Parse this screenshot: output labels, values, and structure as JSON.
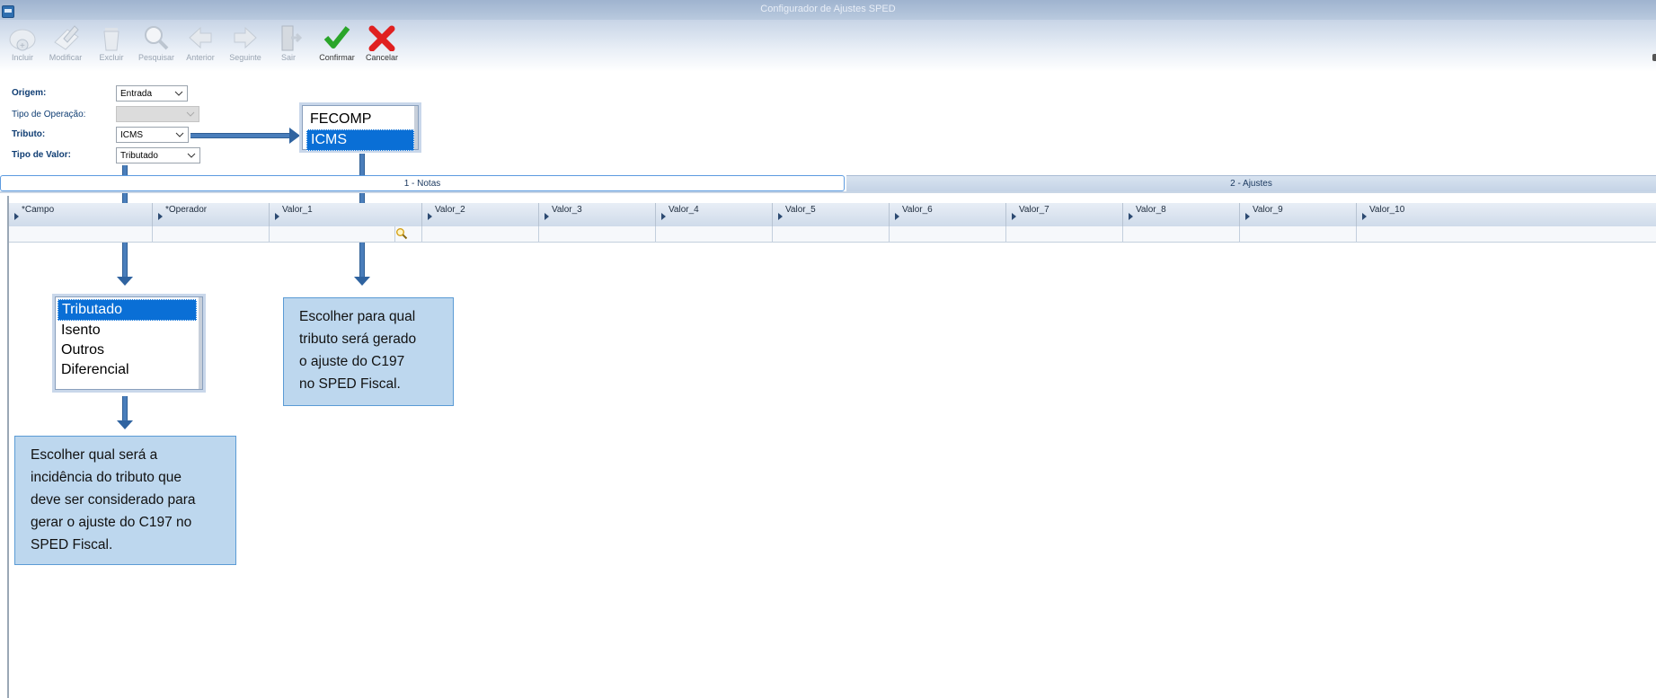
{
  "window": {
    "title": "Configurador de Ajustes SPED"
  },
  "toolbar": {
    "buttons": [
      {
        "label": "Incluir",
        "icon": "include-icon",
        "enabled": false
      },
      {
        "label": "Modificar",
        "icon": "edit-icon",
        "enabled": false
      },
      {
        "label": "Excluir",
        "icon": "trash-icon",
        "enabled": false
      },
      {
        "label": "Pesquisar",
        "icon": "search-icon",
        "enabled": false
      },
      {
        "label": "Anterior",
        "icon": "arrow-left-icon",
        "enabled": false
      },
      {
        "label": "Seguinte",
        "icon": "arrow-right-icon",
        "enabled": false
      },
      {
        "label": "Sair",
        "icon": "exit-door-icon",
        "enabled": false
      },
      {
        "label": "Confirmar",
        "icon": "checkmark-icon",
        "enabled": true
      },
      {
        "label": "Cancelar",
        "icon": "x-icon",
        "enabled": true
      }
    ]
  },
  "form": {
    "origem": {
      "label": "Origem:",
      "value": "Entrada"
    },
    "tipo_operacao": {
      "label": "Tipo de Operação:",
      "value": ""
    },
    "tributo": {
      "label": "Tributo:",
      "value": "ICMS"
    },
    "tipo_valor": {
      "label": "Tipo de Valor:",
      "value": "Tributado"
    }
  },
  "tributo_dropdown": {
    "options": [
      "FECOMP",
      "ICMS"
    ],
    "selected": "ICMS"
  },
  "tipo_valor_dropdown": {
    "options": [
      "Tributado",
      "Isento",
      "Outros",
      "Diferencial"
    ],
    "selected": "Tributado"
  },
  "tabs": [
    {
      "label": "1 - Notas",
      "active": true
    },
    {
      "label": "2 - Ajustes",
      "active": false
    }
  ],
  "grid": {
    "columns": [
      "*Campo",
      "*Operador",
      "Valor_1",
      "Valor_2",
      "Valor_3",
      "Valor_4",
      "Valor_5",
      "Valor_6",
      "Valor_7",
      "Valor_8",
      "Valor_9",
      "Valor_10"
    ]
  },
  "callouts": {
    "tributo": [
      "Escolher para qual",
      "tributo será gerado",
      "o ajuste do C197",
      "no SPED Fiscal."
    ],
    "tipo_valor": [
      "Escolher qual será a",
      "incidência do tributo que",
      "deve ser considerado para",
      "gerar o ajuste do C197 no",
      "SPED Fiscal."
    ]
  },
  "colors": {
    "accent": "#0a6fd6",
    "callout_bg": "#bdd7ee",
    "arrow": "#4a7ebb",
    "confirm": "#2aa52a",
    "cancel": "#e02020"
  }
}
